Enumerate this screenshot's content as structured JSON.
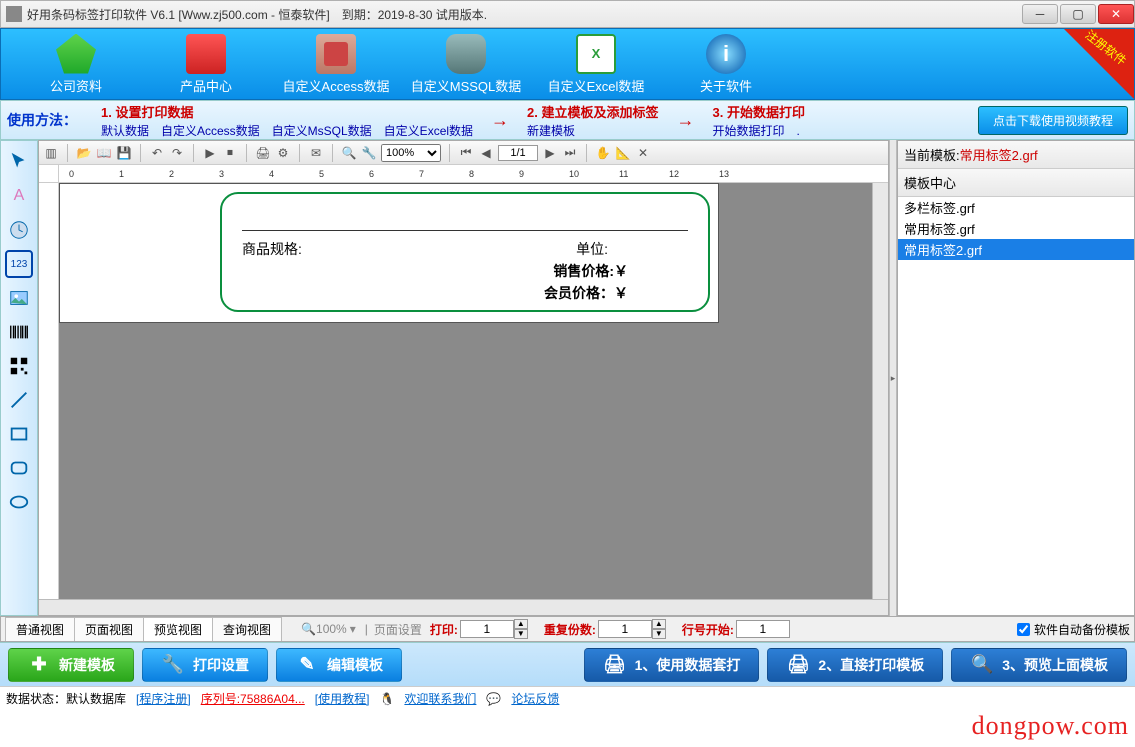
{
  "titlebar": {
    "title": "好用条码标签打印软件 V6.1 [Www.zj500.com - 恒泰软件]　到期：2019-8-30 试用版本."
  },
  "ribbon": {
    "items": [
      {
        "label": "公司资料",
        "color": "#1fb84a"
      },
      {
        "label": "产品中心",
        "color": "#e23"
      },
      {
        "label": "自定义Access数据",
        "color": "#d95"
      },
      {
        "label": "自定义MSSQL数据",
        "color": "#5aa"
      },
      {
        "label": "自定义Excel数据",
        "color": "#2a9d3a"
      },
      {
        "label": "关于软件",
        "color": "#2a8fe0"
      }
    ],
    "corner": "注册软件"
  },
  "helprow": {
    "label": "使用方法：",
    "steps": [
      {
        "t1": "1. 设置打印数据",
        "t2": "默认数据　自定义Access数据　自定义MsSQL数据　自定义Excel数据"
      },
      {
        "t1": "2. 建立模板及添加标签",
        "t2": "新建模板"
      },
      {
        "t1": "3. 开始数据打印",
        "t2": "开始数据打印　."
      }
    ],
    "arrow": "→",
    "button": "点击下载使用视频教程"
  },
  "toolbar": {
    "zoom": "100%",
    "page": "1/1"
  },
  "label_card": {
    "r1a": "商品规格:",
    "r1b": "单位:",
    "r2": "销售价格:￥",
    "r3": "会员价格：￥"
  },
  "rightpanel": {
    "current_label": "当前模板:",
    "current_value": "常用标签2.grf",
    "center_label": "模板中心",
    "items": [
      "多栏标签.grf",
      "常用标签.grf",
      "常用标签2.grf"
    ],
    "selected": 2
  },
  "tabs": {
    "tabs": [
      "普通视图",
      "页面视图",
      "预览视图",
      "查询视图"
    ],
    "active": 2,
    "zoom": "100%",
    "pageset": "页面设置",
    "print_label": "打印:",
    "print_value": "1",
    "repeat_label": "重复份数:",
    "repeat_value": "1",
    "line_label": "行号开始:",
    "line_value": "1",
    "autobak": "软件自动备份模板"
  },
  "actions": {
    "b1": "新建模板",
    "b2": "打印设置",
    "b3": "编辑模板",
    "b4": "1、使用数据套打",
    "b5": "2、直接打印模板",
    "b6": "3、预览上面模板"
  },
  "status": {
    "s1": "数据状态：默认数据库",
    "s2": "[程序注册]",
    "s3_label": "序列号:",
    "s3_value": "75886A04...",
    "s4": "[使用教程]",
    "s5": "欢迎联系我们",
    "s6": "论坛反馈"
  },
  "watermark": "dongpow.com"
}
